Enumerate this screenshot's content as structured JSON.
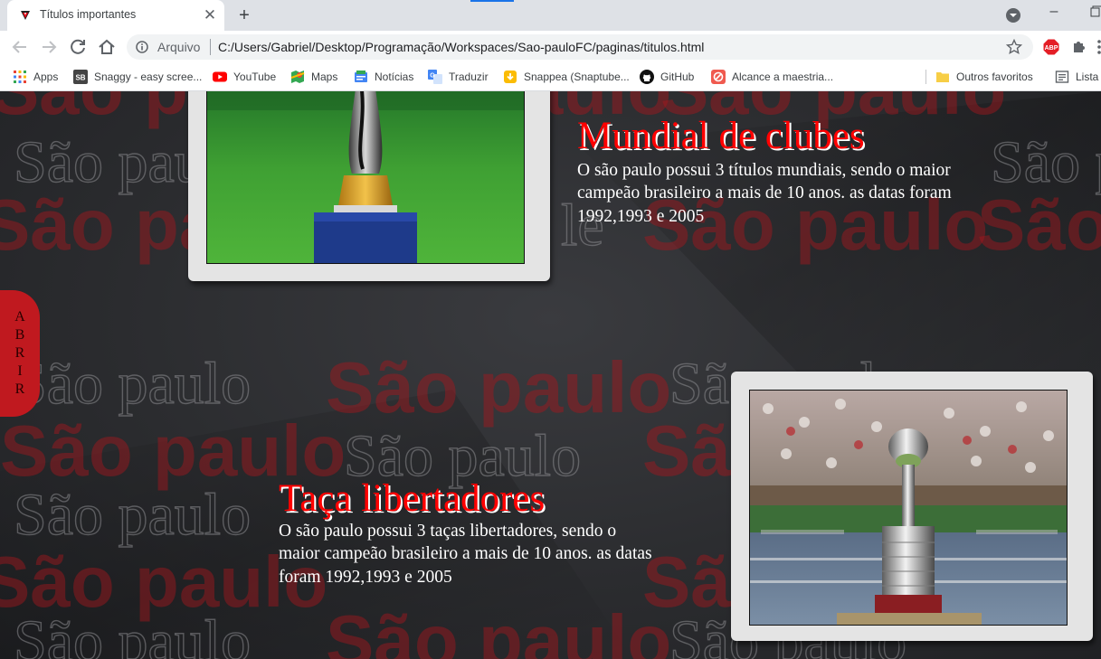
{
  "browser": {
    "tab": {
      "title": "Títulos importantes",
      "close": "✕"
    },
    "new_tab": "+",
    "omnibox": {
      "origin": "Arquivo",
      "url": "C:/Users/Gabriel/Desktop/Programação/Workspaces/Sao-pauloFC/paginas/titulos.html"
    },
    "bookmarks": [
      {
        "label": "Apps",
        "icon": "apps-grid-icon"
      },
      {
        "label": "Snaggy - easy scree...",
        "icon": "snaggy-icon"
      },
      {
        "label": "YouTube",
        "icon": "youtube-icon"
      },
      {
        "label": "Maps",
        "icon": "maps-icon"
      },
      {
        "label": "Notícias",
        "icon": "news-icon"
      },
      {
        "label": "Traduzir",
        "icon": "translate-icon"
      },
      {
        "label": "Snappea (Snaptube...",
        "icon": "snappea-icon"
      },
      {
        "label": "GitHub",
        "icon": "github-icon"
      },
      {
        "label": "Alcance a maestria...",
        "icon": "maestria-icon"
      },
      {
        "label": "Outros favoritos",
        "icon": "folder-icon"
      },
      {
        "label": "Lista d",
        "icon": "reading-list-icon"
      }
    ]
  },
  "page": {
    "open_tab_letters": [
      "A",
      "B",
      "R",
      "I",
      "R"
    ],
    "background_words": {
      "outline": "São paulo",
      "bold": "São paulo",
      "partial_le": "le"
    },
    "sections": [
      {
        "title": "Mundial de clubes",
        "description": "O são paulo possui 3 títulos mundiais, sendo o maior campeão brasileiro a mais de 10 anos. as datas foram 1992,1993 e 2005",
        "image": "club-world-cup-trophy"
      },
      {
        "title": "Taça libertadores",
        "description": "O são paulo possui 3 taças libertadores, sendo o maior campeão brasileiro a mais de 10 anos. as datas foram 1992,1993 e 2005",
        "image": "libertadores-trophy"
      }
    ]
  },
  "colors": {
    "title_red": "#ff0000",
    "open_tab_red": "#c0191f",
    "page_bg": "#2b2c2f",
    "card_frame": "#e4e4e4"
  }
}
